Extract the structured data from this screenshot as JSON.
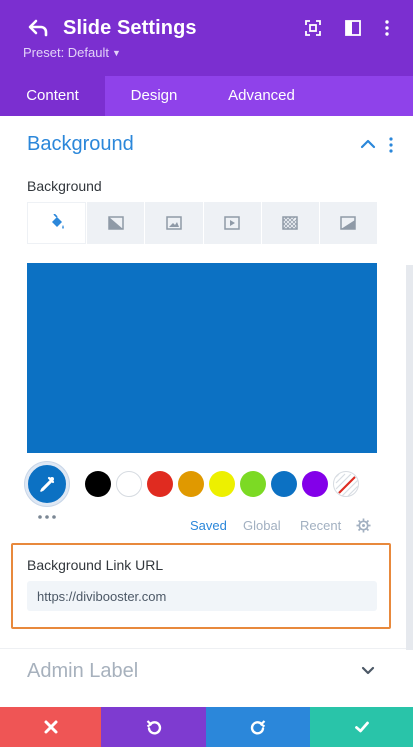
{
  "header": {
    "title": "Slide Settings",
    "preset_label": "Preset: Default",
    "bg_color": "#7b2fd0"
  },
  "tabs": [
    {
      "label": "Content",
      "active": true
    },
    {
      "label": "Design",
      "active": false
    },
    {
      "label": "Advanced",
      "active": false
    }
  ],
  "background_section": {
    "title": "Background",
    "field_label": "Background",
    "bg_type_tabs": [
      "color-icon",
      "gradient-icon",
      "image-icon",
      "video-icon",
      "pattern-icon",
      "mask-icon"
    ],
    "selected_color": "#0c71c3",
    "swatches": [
      "#000000",
      "#ffffff",
      "#e02b20",
      "#e09900",
      "#edf000",
      "#7cda24",
      "#0c71c3",
      "#8300e9",
      "none"
    ],
    "palette_tabs": [
      {
        "label": "Saved",
        "active": true
      },
      {
        "label": "Global",
        "active": false
      },
      {
        "label": "Recent",
        "active": false
      }
    ]
  },
  "link_url": {
    "label": "Background Link URL",
    "value": "https://divibooster.com"
  },
  "admin_section": {
    "title": "Admin Label"
  },
  "footer": {
    "colors": {
      "cancel": "#ef5555",
      "undo": "#7e3bd0",
      "redo": "#2b87da",
      "save": "#29c4a9"
    }
  }
}
